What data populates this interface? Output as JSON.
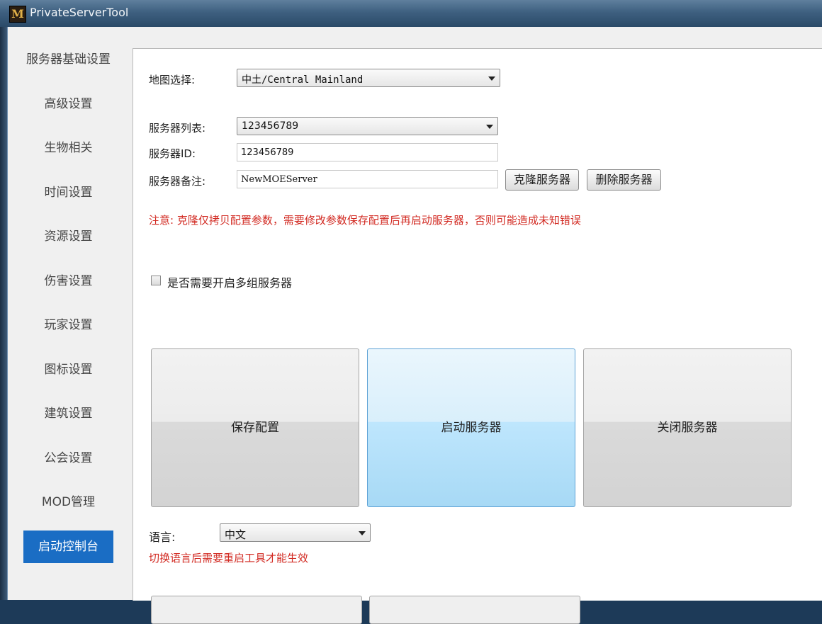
{
  "window": {
    "title": "PrivateServerTool",
    "icon_letter": "M"
  },
  "sidebar": {
    "items": [
      {
        "label": "服务器基础设置"
      },
      {
        "label": "高级设置"
      },
      {
        "label": "生物相关"
      },
      {
        "label": "时间设置"
      },
      {
        "label": "资源设置"
      },
      {
        "label": "伤害设置"
      },
      {
        "label": "玩家设置"
      },
      {
        "label": "图标设置"
      },
      {
        "label": "建筑设置"
      },
      {
        "label": "公会设置"
      },
      {
        "label": "MOD管理"
      },
      {
        "label": "启动控制台",
        "active": true
      }
    ]
  },
  "form": {
    "map_label": "地图选择:",
    "map_value": "中土/Central Mainland",
    "server_list_label": "服务器列表:",
    "server_list_value": "123456789",
    "server_id_label": "服务器ID:",
    "server_id_value": "123456789",
    "server_note_label": "服务器备注:",
    "server_note_value": "NewMOEServer",
    "clone_button": "克隆服务器",
    "delete_button": "删除服务器",
    "clone_warning": "注意: 克隆仅拷贝配置参数，需要修改参数保存配置后再启动服务器，否则可能造成未知错误",
    "multi_group_label": "是否需要开启多组服务器",
    "multi_group_checked": false
  },
  "actions": {
    "save_config": "保存配置",
    "start_server": "启动服务器",
    "stop_server": "关闭服务器"
  },
  "language": {
    "label": "语言:",
    "value": "中文",
    "restart_notice": "切换语言后需要重启工具才能生效"
  },
  "colors": {
    "accent": "#1a6dc4",
    "warning": "#d22a22"
  }
}
